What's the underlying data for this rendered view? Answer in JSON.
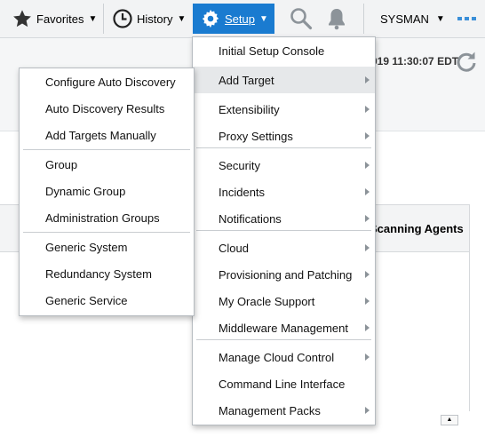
{
  "topbar": {
    "favorites_label": "Favorites",
    "history_label": "History",
    "setup_label": "Setup",
    "user_label": "SYSMAN"
  },
  "page": {
    "timestamp": "019 11:30:07 EDT",
    "column_header": "Scanning Agents"
  },
  "setup_menu": {
    "items": [
      {
        "label": "Initial Setup Console",
        "submenu": false
      },
      {
        "label": "Add Target",
        "submenu": true
      },
      {
        "label": "Extensibility",
        "submenu": true
      },
      {
        "label": "Proxy Settings",
        "submenu": true
      },
      {
        "label": "Security",
        "submenu": true
      },
      {
        "label": "Incidents",
        "submenu": true
      },
      {
        "label": "Notifications",
        "submenu": true
      },
      {
        "label": "Cloud",
        "submenu": true
      },
      {
        "label": "Provisioning and Patching",
        "submenu": true
      },
      {
        "label": "My Oracle Support",
        "submenu": true
      },
      {
        "label": "Middleware Management",
        "submenu": true
      },
      {
        "label": "Manage Cloud Control",
        "submenu": true
      },
      {
        "label": "Command Line Interface",
        "submenu": false
      },
      {
        "label": "Management Packs",
        "submenu": true
      }
    ]
  },
  "add_target_menu": {
    "items": [
      {
        "label": "Configure Auto Discovery"
      },
      {
        "label": "Auto Discovery Results"
      },
      {
        "label": "Add Targets Manually"
      },
      {
        "label": "Group"
      },
      {
        "label": "Dynamic Group"
      },
      {
        "label": "Administration Groups"
      },
      {
        "label": "Generic System"
      },
      {
        "label": "Redundancy System"
      },
      {
        "label": "Generic Service"
      }
    ]
  },
  "colors": {
    "setup_active": "#1a7bd0",
    "icon_gray": "#8c9399",
    "menu_highlight": "#e6e8ea"
  }
}
